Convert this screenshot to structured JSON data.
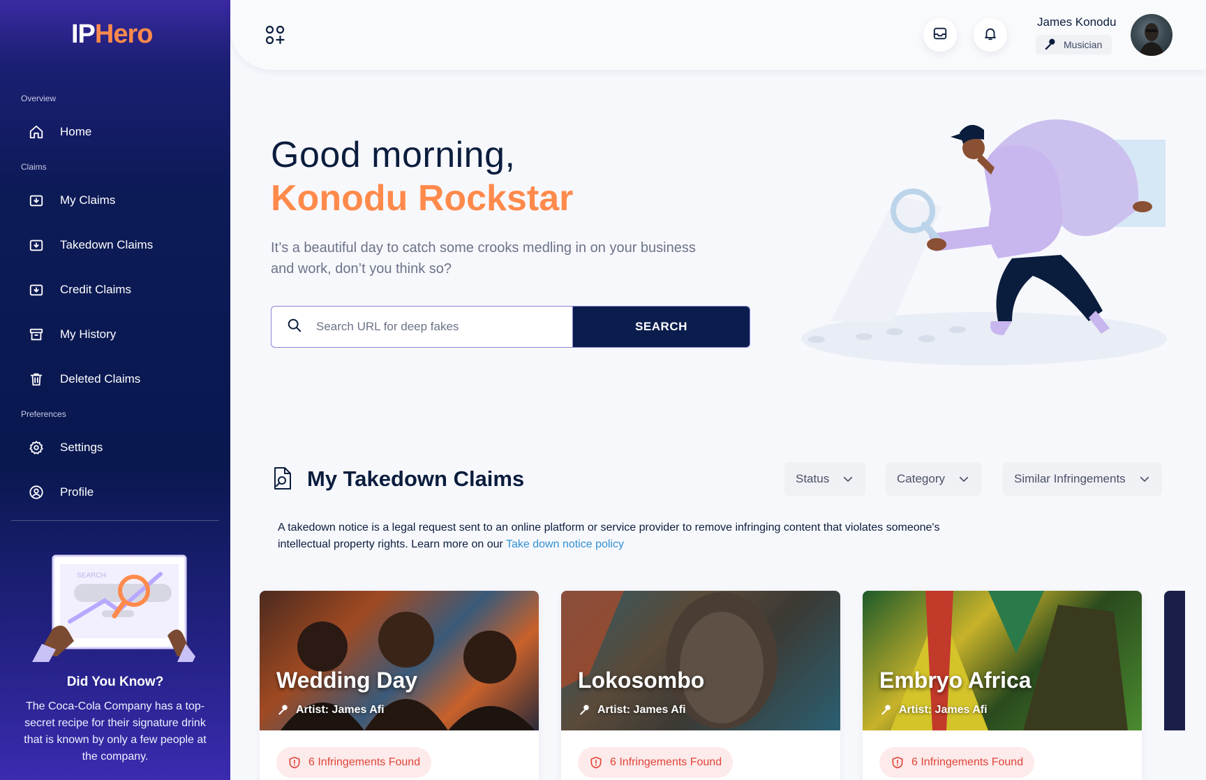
{
  "brand": {
    "part1": "IP",
    "part2": "Hero"
  },
  "sidebar": {
    "sections": [
      "Overview",
      "Claims",
      "Preferences"
    ],
    "items": [
      {
        "label": "Home",
        "icon": "home-icon"
      },
      {
        "label": "My Claims",
        "icon": "download-box-icon"
      },
      {
        "label": "Takedown Claims",
        "icon": "download-box-icon"
      },
      {
        "label": "Credit Claims",
        "icon": "download-box-icon"
      },
      {
        "label": "My History",
        "icon": "archive-icon"
      },
      {
        "label": "Deleted Claims",
        "icon": "trash-icon"
      },
      {
        "label": "Settings",
        "icon": "gear-icon"
      },
      {
        "label": "Profile",
        "icon": "user-circle-icon"
      }
    ],
    "did_you_know": {
      "illustration_text": "SEARCH",
      "title": "Did You Know?",
      "text": "The Coca-Cola Company has a top-secret recipe for their signature drink that is known by only a few people at the company."
    }
  },
  "header": {
    "user_name": "James Konodu",
    "user_role": "Musician"
  },
  "hero": {
    "greeting": "Good morning,",
    "name": "Konodu Rockstar",
    "subtitle": "It’s a beautiful day to catch some crooks medling in on your business and work, don’t you think so?",
    "search_placeholder": "Search URL for deep fakes",
    "search_button": "SEARCH"
  },
  "takedown": {
    "title": "My Takedown Claims",
    "filters": [
      "Status",
      "Category",
      "Similar Infringements"
    ],
    "description": "A takedown notice is a legal request sent to an online platform or service provider to remove infringing content that violates someone's intellectual property rights. Learn more on our ",
    "link_text": "Take down notice policy",
    "cards": [
      {
        "title": "Wedding Day",
        "artist": "Artist: James Afi",
        "infringements": "6 Infringements Found"
      },
      {
        "title": "Lokosombo",
        "artist": "Artist: James Afi",
        "infringements": "6 Infringements Found"
      },
      {
        "title": "Embryo Africa",
        "artist": "Artist: James Afi",
        "infringements": "6 Infringements Found"
      }
    ]
  },
  "colors": {
    "accent_orange": "#ff8a4c",
    "navy": "#0b1d4d",
    "danger": "#e0453a",
    "link": "#2f8fd6"
  }
}
